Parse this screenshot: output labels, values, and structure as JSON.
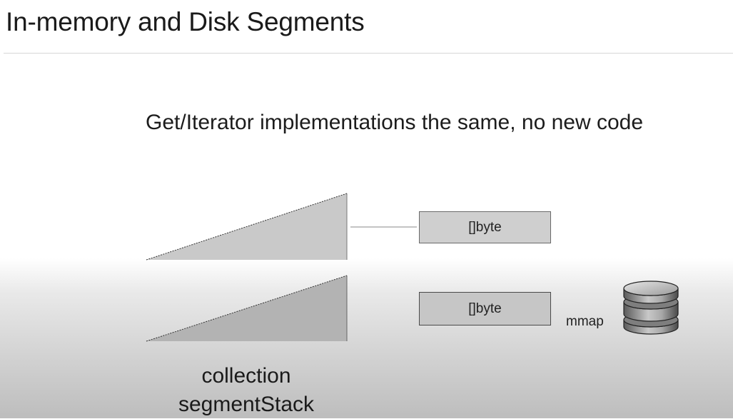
{
  "slide": {
    "title": "In-memory and Disk Segments",
    "subtitle": "Get/Iterator implementations the same, no new code"
  },
  "diagram": {
    "top_buffer_label": "[]byte",
    "bottom_buffer_label": "[]byte",
    "mmap_label": "mmap",
    "caption_line1": "collection",
    "caption_line2": "segmentStack",
    "icons": {
      "disk": "database-icon"
    }
  }
}
